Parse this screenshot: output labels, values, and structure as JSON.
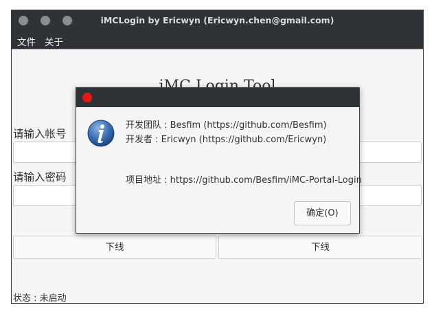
{
  "window": {
    "title": "iMCLogin by Ericwyn (Ericwyn.chen@gmail.com)"
  },
  "menu": {
    "items": [
      "文件",
      "关于"
    ]
  },
  "main": {
    "heading": "iMC Login Tool",
    "account_label": "请输入帐号",
    "account_value": "",
    "password_label": "请输入密码",
    "password_value": "",
    "buttons": [
      "下线",
      "下线"
    ],
    "status": "状态 : 未启动"
  },
  "dialog": {
    "icon": "info-icon",
    "lines": [
      "开发团队 : Besfim (https://github.com/Besfim)",
      "开发者  : Ericwyn (https://github.com/Ericwyn)",
      "项目地址 : https://github.com/Besfim/iMC-Portal-Login"
    ],
    "ok_label": "确定(O)"
  },
  "colors": {
    "titlebar": "#2f3337",
    "close": "#e01b1b",
    "info_blue": "#2d5f9e"
  }
}
